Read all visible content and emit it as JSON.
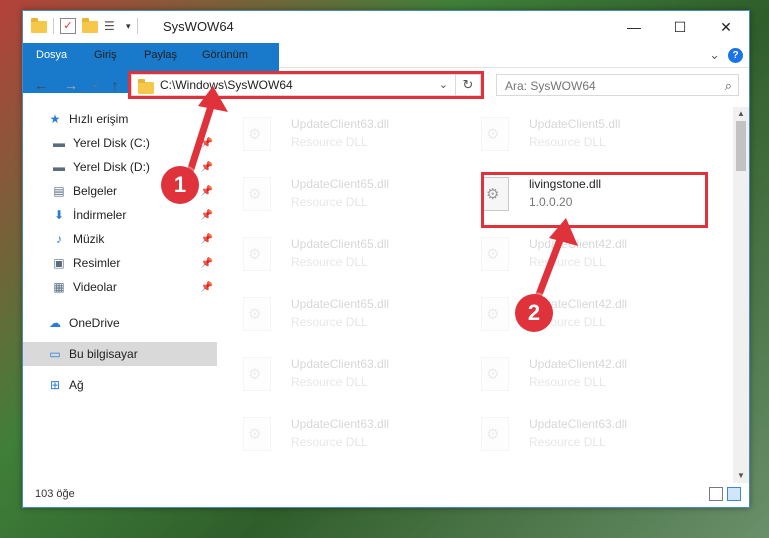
{
  "window": {
    "title": "SysWOW64",
    "controls": {
      "minimize": "—",
      "maximize": "☐",
      "close": "✕"
    }
  },
  "ribbon": {
    "tabs": [
      {
        "label": "Dosya",
        "active": true
      },
      {
        "label": "Giriş"
      },
      {
        "label": "Paylaş"
      },
      {
        "label": "Görünüm"
      }
    ],
    "expand_chevron": "⌄",
    "help": "?"
  },
  "nav": {
    "back": "←",
    "forward": "→",
    "recent": "⌄",
    "up": "↑",
    "address": "C:\\Windows\\SysWOW64",
    "address_chevron": "⌄",
    "refresh": "↻",
    "search_placeholder": "Ara: SysWOW64",
    "search_icon": "⌕"
  },
  "sidebar": {
    "items": [
      {
        "label": "Hızlı erişim",
        "icon": "star-icon",
        "glyph": "★",
        "color": "#2a7bd6",
        "pinned": false
      },
      {
        "label": "Yerel Disk (C:)",
        "icon": "drive-icon",
        "glyph": "▬",
        "color": "#5a6d80",
        "pinned": true
      },
      {
        "label": "Yerel Disk (D:)",
        "icon": "drive-icon",
        "glyph": "▬",
        "color": "#5a6d80",
        "pinned": true
      },
      {
        "label": "Belgeler",
        "icon": "documents-icon",
        "glyph": "▤",
        "color": "#5a6d80",
        "pinned": true
      },
      {
        "label": "İndirmeler",
        "icon": "download-icon",
        "glyph": "⬇",
        "color": "#2a7bd6",
        "pinned": true
      },
      {
        "label": "Müzik",
        "icon": "music-icon",
        "glyph": "♪",
        "color": "#2a7bd6",
        "pinned": true
      },
      {
        "label": "Resimler",
        "icon": "pictures-icon",
        "glyph": "▣",
        "color": "#5a6d80",
        "pinned": true
      },
      {
        "label": "Videolar",
        "icon": "videos-icon",
        "glyph": "▦",
        "color": "#5a6d80",
        "pinned": true
      },
      {
        "label": "OneDrive",
        "icon": "cloud-icon",
        "glyph": "☁",
        "color": "#2a7bd6",
        "pinned": false
      },
      {
        "label": "Bu bilgisayar",
        "icon": "computer-icon",
        "glyph": "▭",
        "color": "#2a7bd6",
        "pinned": false,
        "selected": true
      },
      {
        "label": "Ağ",
        "icon": "network-icon",
        "glyph": "⊞",
        "color": "#2a7bd6",
        "pinned": false
      }
    ],
    "pin_glyph": "📌"
  },
  "files": {
    "left": [
      {
        "name": "UpdateClient63.dll",
        "desc": "Resource DLL"
      },
      {
        "name": "UpdateClient65.dll",
        "desc": "Resource DLL"
      },
      {
        "name": "UpdateClient65.dll",
        "desc": "Resource DLL"
      },
      {
        "name": "UpdateClient65.dll",
        "desc": "Resource DLL"
      },
      {
        "name": "UpdateClient63.dll",
        "desc": "Resource DLL"
      },
      {
        "name": "UpdateClient63.dll",
        "desc": "Resource DLL"
      }
    ],
    "right": [
      {
        "name": "UpdateClient5.dll",
        "desc": "Resource DLL"
      },
      {
        "name": "livingstone.dll",
        "desc": "1.0.0.20",
        "highlighted": true
      },
      {
        "name": "UpdateClient42.dll",
        "desc": "Resource DLL"
      },
      {
        "name": "UpdateClient42.dll",
        "desc": "Resource DLL"
      },
      {
        "name": "UpdateClient42.dll",
        "desc": "Resource DLL"
      },
      {
        "name": "UpdateClient63.dll",
        "desc": "Resource DLL"
      }
    ]
  },
  "status": {
    "count": "103 öğe"
  },
  "annotations": [
    {
      "label": "1"
    },
    {
      "label": "2"
    }
  ],
  "colors": {
    "accent": "#1979ca",
    "annotation": "#e0323a"
  }
}
